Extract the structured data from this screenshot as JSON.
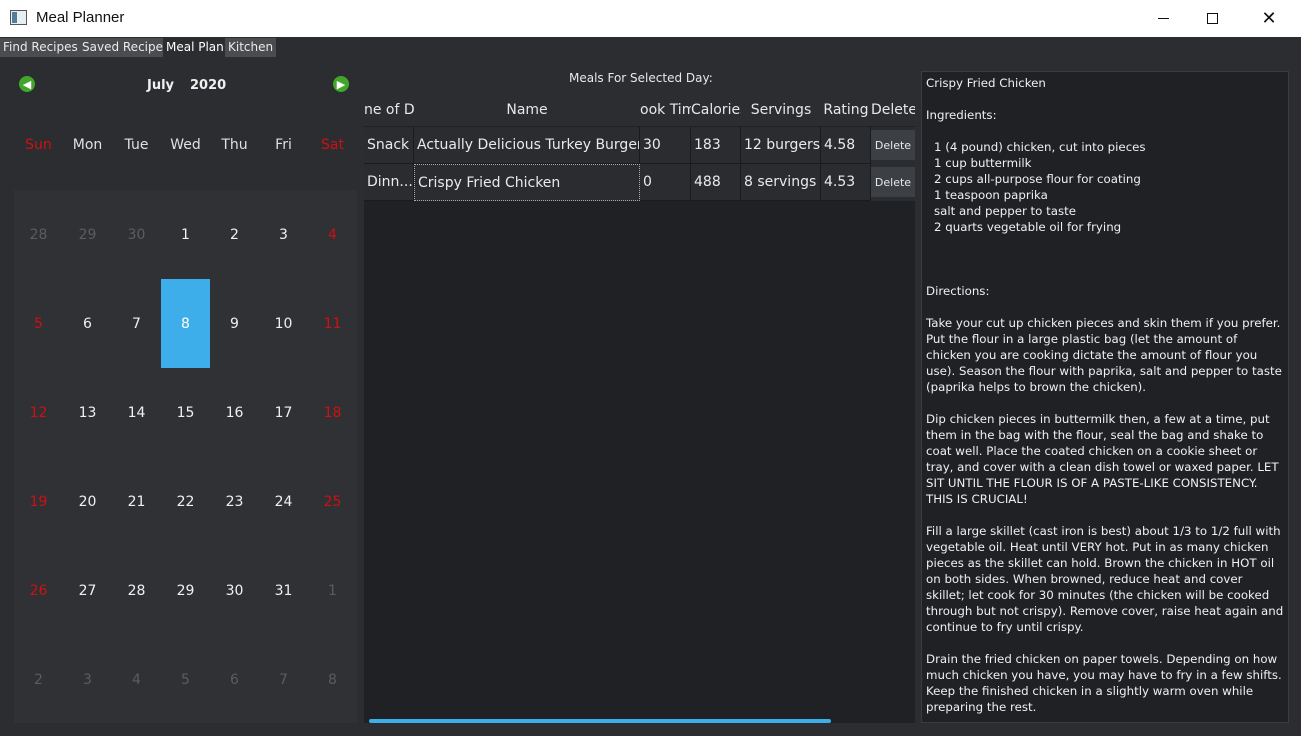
{
  "window": {
    "title": "Meal Planner",
    "minimize_icon": "minimize-icon",
    "maximize_icon": "maximize-icon",
    "close_icon": "close-icon"
  },
  "tabs": [
    "Find Recipes",
    "Saved Recipes",
    "Meal Plan",
    "Kitchen"
  ],
  "active_tab": "Meal Plan",
  "calendar": {
    "month": "July",
    "year": "2020",
    "weekdays": [
      "Sun",
      "Mon",
      "Tue",
      "Wed",
      "Thu",
      "Fri",
      "Sat"
    ],
    "weeks": [
      [
        "28",
        "29",
        "30",
        "1",
        "2",
        "3",
        "4"
      ],
      [
        "5",
        "6",
        "7",
        "8",
        "9",
        "10",
        "11"
      ],
      [
        "12",
        "13",
        "14",
        "15",
        "16",
        "17",
        "18"
      ],
      [
        "19",
        "20",
        "21",
        "22",
        "23",
        "24",
        "25"
      ],
      [
        "26",
        "27",
        "28",
        "29",
        "30",
        "31",
        "1"
      ],
      [
        "2",
        "3",
        "4",
        "5",
        "6",
        "7",
        "8"
      ]
    ],
    "selected_day": "8",
    "accent_color": "#3daee9",
    "weekend_color": "#d01010"
  },
  "meals": {
    "title": "Meals For Selected Day:",
    "columns": [
      "ne of D",
      "Name",
      "ook Tim",
      "Calories",
      "Servings",
      "Rating",
      "Delete"
    ],
    "rows": [
      {
        "type": "Snack",
        "name": "Actually Delicious Turkey Burgers",
        "cook_time": "30",
        "calories": "183",
        "servings": "12 burgers",
        "rating": "4.58",
        "delete": "Delete"
      },
      {
        "type": "Dinn...",
        "name": "Crispy Fried Chicken",
        "cook_time": "0",
        "calories": "488",
        "servings": "8 servings",
        "rating": "4.53",
        "delete": "Delete"
      }
    ]
  },
  "recipe": {
    "title": "Crispy Fried Chicken",
    "ingredients_label": "Ingredients:",
    "ingredients": [
      "1 (4 pound) chicken, cut into pieces",
      "1 cup buttermilk",
      "2 cups all-purpose flour for coating",
      "1 teaspoon paprika",
      "salt and pepper to taste",
      "2 quarts vegetable oil for frying"
    ],
    "directions_label": "Directions:",
    "directions": [
      "Take your cut up chicken pieces and skin them if you prefer. Put the flour in a large plastic bag (let the amount of chicken you are cooking dictate the amount of flour you use). Season the flour with paprika, salt and pepper to taste (paprika helps to brown the chicken).",
      "Dip chicken pieces in buttermilk then, a few at a time, put them in the bag with the flour, seal the bag and shake to coat well. Place the coated chicken on a cookie sheet or tray, and cover with a clean dish towel or waxed paper. LET SIT UNTIL THE FLOUR IS OF A PASTE-LIKE CONSISTENCY. THIS IS CRUCIAL!",
      "Fill a large skillet (cast iron is best) about 1/3 to 1/2 full with vegetable oil. Heat until VERY hot. Put in as many chicken pieces as the skillet can hold. Brown the chicken in HOT oil on both sides. When browned, reduce heat and cover skillet; let cook for 30 minutes (the chicken will be cooked through but not crispy). Remove cover, raise heat again and continue to fry until crispy.",
      "Drain the fried chicken on paper towels. Depending on how much chicken you have, you may have to fry in a few shifts. Keep the finished chicken in a slightly warm oven while preparing the rest."
    ]
  }
}
